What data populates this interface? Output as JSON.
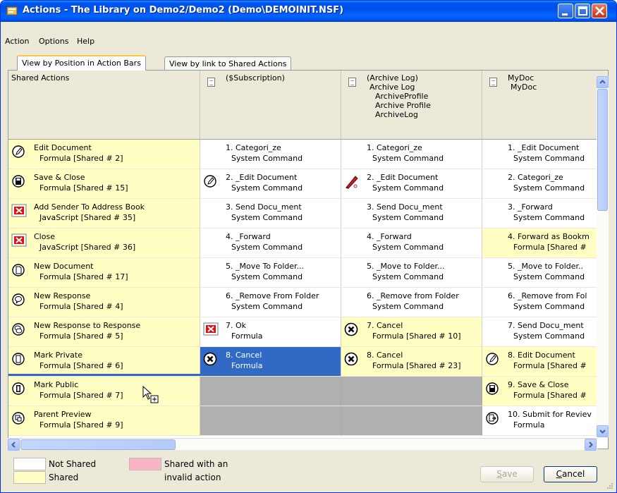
{
  "window": {
    "title": "Actions - The Library on Demo2/Demo2 (Demo\\DEMOINIT.NSF)"
  },
  "menu": [
    {
      "label": "Action"
    },
    {
      "label": "Options"
    },
    {
      "label": "Help"
    }
  ],
  "tabs": [
    {
      "label": "View by Position in Action Bars",
      "active": true
    },
    {
      "label": "View by link to Shared Actions",
      "active": false
    }
  ],
  "columns": [
    {
      "header": [
        "Shared Actions"
      ]
    },
    {
      "header": [
        "($Subscription)"
      ]
    },
    {
      "header": [
        "(Archive Log)",
        "Archive Log",
        "ArchiveProfile",
        "Archive Profile",
        "ArchiveLog"
      ]
    },
    {
      "header": [
        "MyDoc",
        "MyDoc"
      ]
    }
  ],
  "rows": [
    [
      {
        "t1": "Edit Document",
        "t2": "Formula [Shared # 2]",
        "icon": "pencil-icon",
        "kind": "shared"
      },
      {
        "t1": "1. Categori_ze",
        "t2": "System Command",
        "icon": "",
        "kind": "plain"
      },
      {
        "t1": "1. Categori_ze",
        "t2": "System Command",
        "icon": "",
        "kind": "plain"
      },
      {
        "t1": "1. _Edit Document",
        "t2": "System Command",
        "icon": "",
        "kind": "plain"
      }
    ],
    [
      {
        "t1": "Save & Close",
        "t2": "Formula [Shared # 15]",
        "icon": "disk-icon",
        "kind": "shared"
      },
      {
        "t1": "2. _Edit Document",
        "t2": "System Command",
        "icon": "pencil-icon",
        "kind": "plain"
      },
      {
        "t1": "2. _Edit Document",
        "t2": "System Command",
        "icon": "quill-icon",
        "kind": "plain"
      },
      {
        "t1": "2. Categori_ze",
        "t2": "System Command",
        "icon": "",
        "kind": "plain"
      }
    ],
    [
      {
        "t1": "Add Sender To Address Book",
        "t2": "JavaScript [Shared # 35]",
        "icon": "broken-image-icon",
        "kind": "shared"
      },
      {
        "t1": "3. Send Docu_ment",
        "t2": "System Command",
        "icon": "",
        "kind": "plain"
      },
      {
        "t1": "3. Send Docu_ment",
        "t2": "System Command",
        "icon": "",
        "kind": "plain"
      },
      {
        "t1": "3. _Forward",
        "t2": "System Command",
        "icon": "",
        "kind": "plain"
      }
    ],
    [
      {
        "t1": "Close",
        "t2": "JavaScript [Shared # 36]",
        "icon": "broken-image-icon",
        "kind": "shared"
      },
      {
        "t1": "4. _Forward",
        "t2": "System Command",
        "icon": "",
        "kind": "plain"
      },
      {
        "t1": "4. _Forward",
        "t2": "System Command",
        "icon": "",
        "kind": "plain"
      },
      {
        "t1": "4. Forward as Bookm",
        "t2": "Formula [Shared #",
        "icon": "",
        "kind": "shared"
      }
    ],
    [
      {
        "t1": "New Document",
        "t2": "Formula [Shared # 17]",
        "icon": "new-document-icon",
        "kind": "shared"
      },
      {
        "t1": "5. _Move To Folder...",
        "t2": "System Command",
        "icon": "",
        "kind": "plain"
      },
      {
        "t1": "5. _Move to Folder...",
        "t2": "System Command",
        "icon": "",
        "kind": "plain"
      },
      {
        "t1": "5. _Move to Folder..",
        "t2": "System Command",
        "icon": "",
        "kind": "plain"
      }
    ],
    [
      {
        "t1": "New Response",
        "t2": "Formula [Shared # 4]",
        "icon": "speech-bubble-icon",
        "kind": "shared"
      },
      {
        "t1": "6. _Remove From Folder",
        "t2": "System Command",
        "icon": "",
        "kind": "plain"
      },
      {
        "t1": "6. _Remove from Folder",
        "t2": "System Command",
        "icon": "",
        "kind": "plain"
      },
      {
        "t1": "6. _Remove from Fol",
        "t2": "System Command",
        "icon": "",
        "kind": "plain"
      }
    ],
    [
      {
        "t1": "New Response to Response",
        "t2": "Formula [Shared # 5]",
        "icon": "double-bubble-icon",
        "kind": "shared"
      },
      {
        "t1": "7. Ok",
        "t2": "Formula",
        "icon": "broken-image-icon",
        "kind": "plain"
      },
      {
        "t1": "7. Cancel",
        "t2": "Formula [Shared # 10]",
        "icon": "cancel-x-icon",
        "kind": "shared"
      },
      {
        "t1": "7. Send Docu_ment",
        "t2": "System Command",
        "icon": "",
        "kind": "plain"
      }
    ],
    [
      {
        "t1": "Mark Private",
        "t2": "Formula [Shared # 6]",
        "icon": "private-doc-icon",
        "kind": "shared"
      },
      {
        "t1": "8. Cancel",
        "t2": "Formula",
        "icon": "cancel-x-icon",
        "kind": "sel"
      },
      {
        "t1": "8. Cancel",
        "t2": "Formula [Shared # 23]",
        "icon": "cancel-x-icon",
        "kind": "shared"
      },
      {
        "t1": "8. Edit Document",
        "t2": "Formula [Shared #",
        "icon": "pencil-icon",
        "kind": "shared"
      }
    ],
    [
      {
        "t1": "Mark Public",
        "t2": "Formula [Shared # 7]",
        "icon": "public-doc-icon",
        "kind": "shared"
      },
      {
        "t1": "",
        "t2": "",
        "icon": "",
        "kind": "empty"
      },
      {
        "t1": "",
        "t2": "",
        "icon": "",
        "kind": "empty"
      },
      {
        "t1": "9. Save & Close",
        "t2": "Formula [Shared #",
        "icon": "disk-icon",
        "kind": "shared"
      }
    ],
    [
      {
        "t1": "Parent Preview",
        "t2": "Formula [Shared # 9]",
        "icon": "preview-icon",
        "kind": "shared"
      },
      {
        "t1": "",
        "t2": "",
        "icon": "",
        "kind": "empty"
      },
      {
        "t1": "",
        "t2": "",
        "icon": "",
        "kind": "empty"
      },
      {
        "t1": "10. Submit for Reviev",
        "t2": "Formula",
        "icon": "submit-icon",
        "kind": "plain"
      }
    ]
  ],
  "legend": {
    "not_shared": "Not Shared",
    "shared": "Shared",
    "invalid_1": "Shared with an",
    "invalid_2": "invalid action",
    "colors": {
      "not_shared": "#ffffff",
      "shared": "#ffffc4",
      "invalid": "#f9b4c6"
    }
  },
  "buttons": {
    "save_prefix": "",
    "save_u": "S",
    "save_rest": "ave",
    "cancel_u": "C",
    "cancel_rest": "ancel"
  }
}
